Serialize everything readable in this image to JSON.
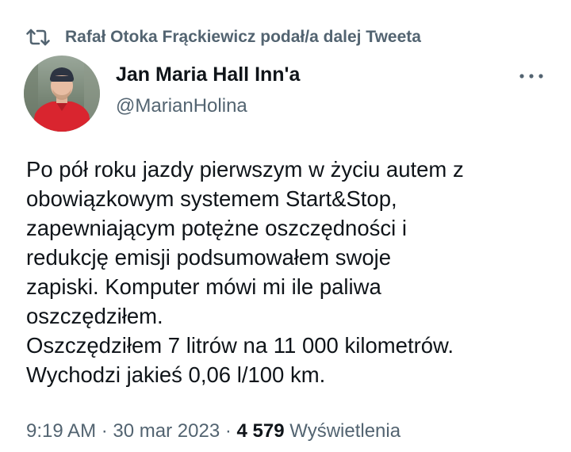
{
  "retweet": {
    "icon": "retweet-icon",
    "text": "Rafał Otoka Frąckiewicz podał/a dalej Tweeta"
  },
  "author": {
    "avatar_icon": "avatar-photo",
    "name": "Jan Maria Hall Inn'a",
    "handle": "@MarianHolina",
    "more_icon": "more-icon"
  },
  "tweet": {
    "lines": [
      "Po pół roku jazdy pierwszym w życiu autem z",
      "obowiązkowym systemem Start&Stop,",
      "zapewniającym potężne oszczędności i",
      "redukcję emisji podsumowałem swoje",
      "zapiski. Komputer mówi mi ile paliwa",
      "oszczędziłem.",
      "Oszczędziłem 7 litrów na 11 000 kilometrów.",
      "Wychodzi jakieś 0,06 l/100 km."
    ]
  },
  "meta": {
    "time": "9:19 AM",
    "separator": "·",
    "date": "30 mar 2023",
    "views_count": "4 579",
    "views_label": "Wyświetlenia"
  },
  "colors": {
    "text_primary": "#0f1419",
    "text_secondary": "#536471",
    "avatar_jacket": "#d9252f"
  }
}
